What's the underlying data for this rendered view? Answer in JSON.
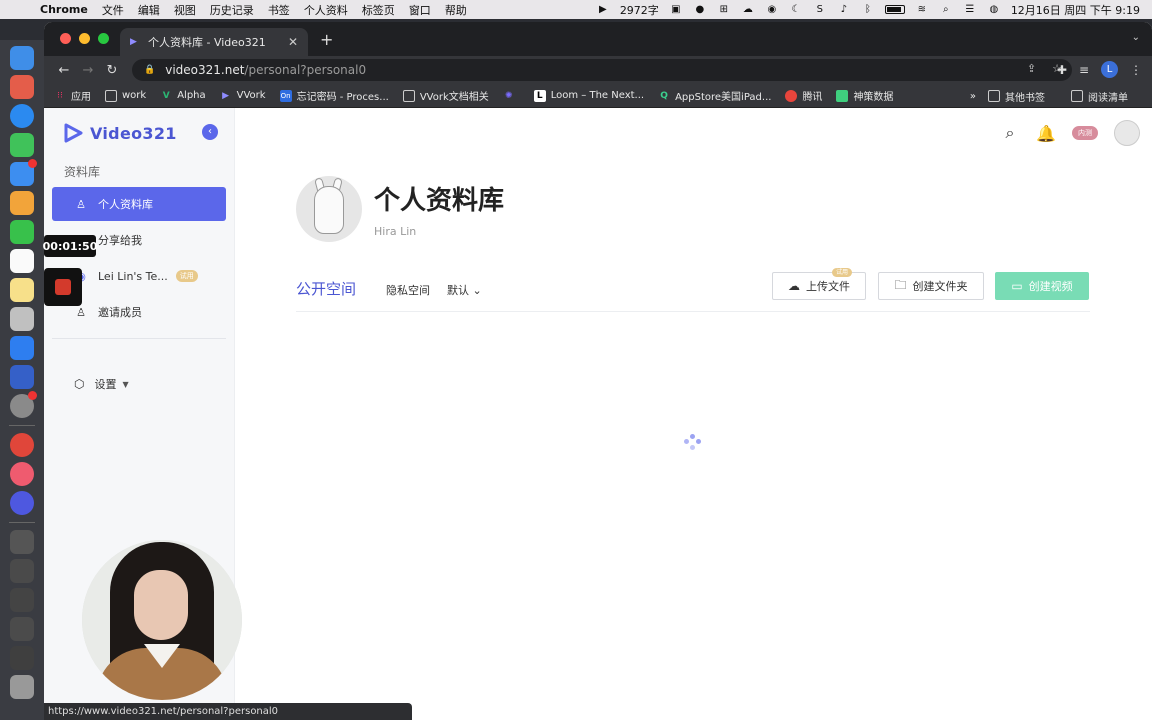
{
  "menubar": {
    "app": "Chrome",
    "items": [
      "文件",
      "编辑",
      "视图",
      "历史记录",
      "书签",
      "个人资料",
      "标签页",
      "窗口",
      "帮助"
    ],
    "word_count": "2972字",
    "datetime": "12月16日 周四 下午 9:19"
  },
  "recording": {
    "timer": "00:01:50"
  },
  "browser": {
    "tab_title": "个人资料库 - Video321",
    "url_host": "video321.net",
    "url_path": "/personal?personal0",
    "profile_initial": "L",
    "bookmarks": [
      {
        "label": "应用",
        "icon": "apps-grid-icon"
      },
      {
        "label": "work",
        "icon": "folder-icon"
      },
      {
        "label": "Alpha",
        "icon": "v-logo-icon"
      },
      {
        "label": "VVork",
        "icon": "video-logo-icon"
      },
      {
        "label": "忘记密码 - Proces...",
        "icon": "on-logo-icon"
      },
      {
        "label": "VVork文档相关",
        "icon": "folder-icon"
      },
      {
        "label": "",
        "icon": "spark-icon"
      },
      {
        "label": "Loom – The Next...",
        "icon": "l-logo-icon"
      },
      {
        "label": "AppStore美国iPad...",
        "icon": "q-logo-icon"
      },
      {
        "label": "腾讯",
        "icon": "chrome-logo-icon"
      },
      {
        "label": "神策数据",
        "icon": "sensors-logo-icon"
      }
    ],
    "bookmarks_other": "其他书签",
    "reading_list": "阅读清单",
    "status_url": "https://www.video321.net/personal?personal0"
  },
  "sidebar": {
    "logo_text": "Video321",
    "section_label": "资料库",
    "items": [
      {
        "label": "个人资料库",
        "icon": "user-icon",
        "active": true
      },
      {
        "label": "分享给我",
        "icon": "share-icon",
        "active": false
      },
      {
        "label": "Lei Lin's Te...",
        "icon": "eye-icon",
        "active": false,
        "badge": "试用"
      },
      {
        "label": "邀请成员",
        "icon": "add-user-icon",
        "active": false
      }
    ],
    "settings_label": "设置"
  },
  "header": {
    "beta_badge": "内测"
  },
  "profile": {
    "title": "个人资料库",
    "name": "Hira Lin"
  },
  "content_tabs": {
    "public": "公开空间",
    "private": "隐私空间",
    "sort": "默认"
  },
  "actions": {
    "upload": "上传文件",
    "upload_badge": "试用",
    "create_folder": "创建文件夹",
    "create_video": "创建视频"
  },
  "colors": {
    "brand": "#5b67ea",
    "create_video_bg": "#79dcb5",
    "trial_badge": "#e8c98a",
    "beta_badge": "#d78c9c"
  }
}
